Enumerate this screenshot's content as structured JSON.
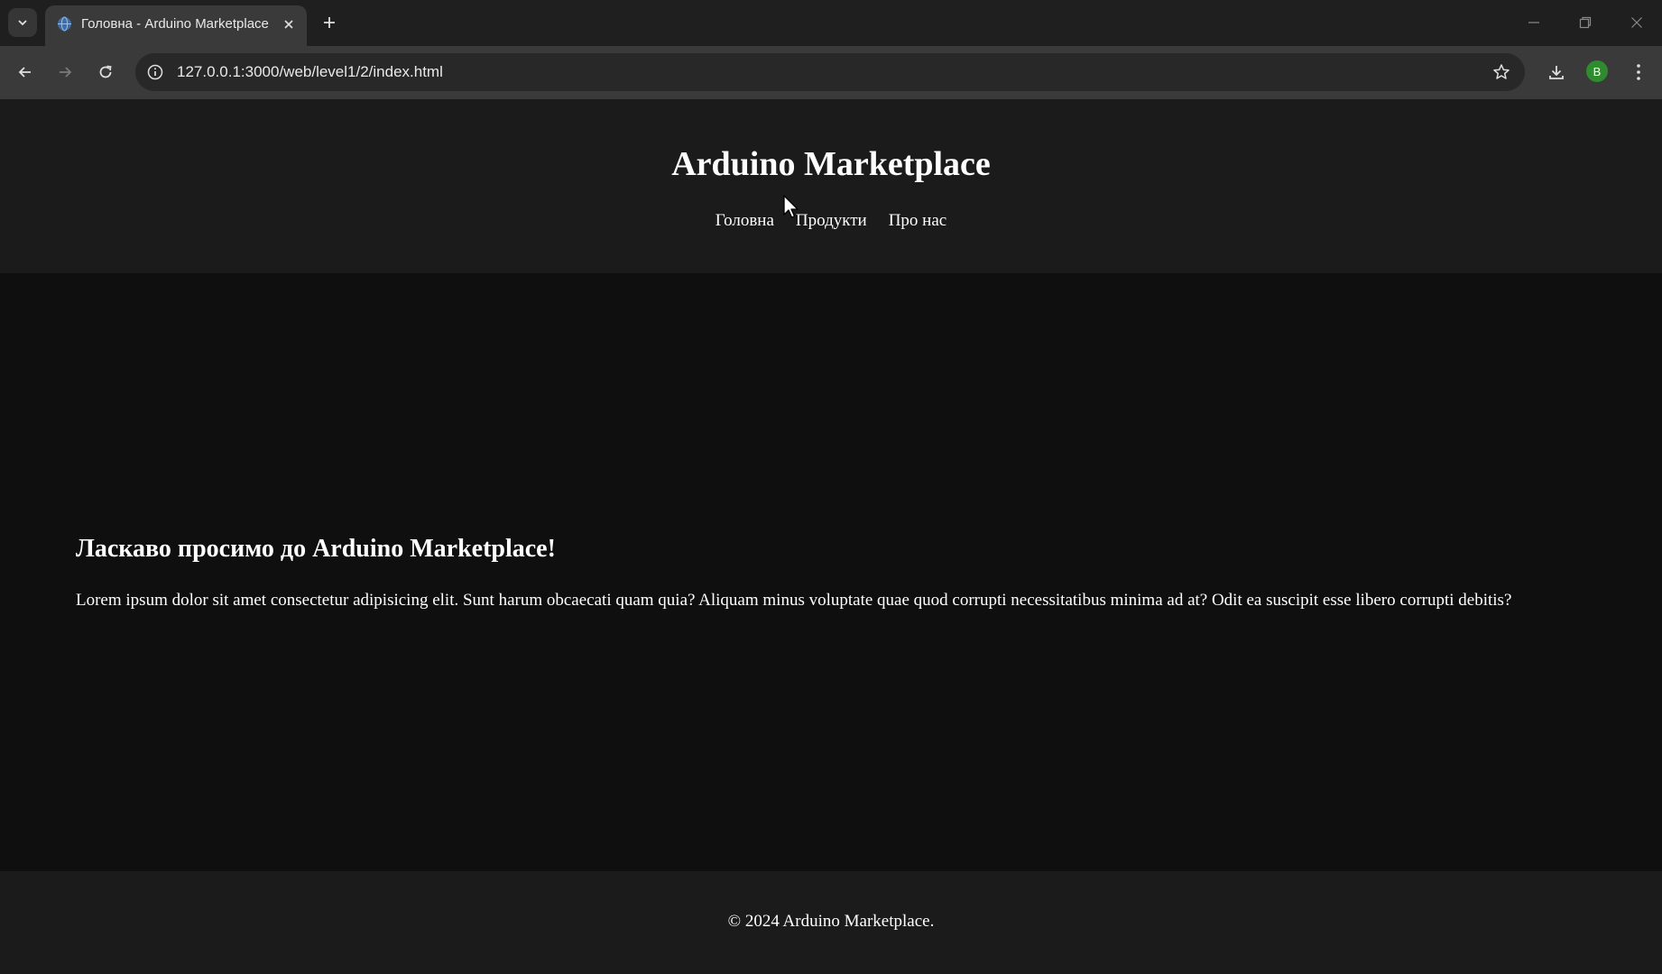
{
  "browser": {
    "tab_title": "Головна - Arduino Marketplace",
    "url": "127.0.0.1:3000/web/level1/2/index.html",
    "profile_initial": "B",
    "icons": {
      "tab_list": "chevron-down-icon",
      "favicon": "globe-icon",
      "tab_close": "close-icon",
      "new_tab": "plus-icon",
      "back": "arrow-left-icon",
      "forward": "arrow-right-icon",
      "reload": "reload-icon",
      "site_info": "info-icon",
      "bookmark": "star-icon",
      "downloads": "download-icon",
      "menu": "kebab-menu-icon",
      "minimize": "minimize-icon",
      "restore": "restore-icon",
      "close_window": "close-icon"
    },
    "colors": {
      "tabstrip": "#1f1f1f",
      "toolbar": "#3a3a3a",
      "omnibox": "#282828",
      "avatar": "#2e8b2e"
    }
  },
  "site": {
    "title": "Arduino Marketplace",
    "nav": {
      "home": "Головна",
      "products": "Продукти",
      "about": "Про нас"
    },
    "welcome_heading": "Ласкаво просимо до Arduino Marketplace!",
    "welcome_text": "Lorem ipsum dolor sit amet consectetur adipisicing elit. Sunt harum obcaecati quam quia? Aliquam minus voluptate quae quod corrupti necessitatibus minima ad at? Odit ea suscipit esse libero corrupti debitis?",
    "footer": "© 2024 Arduino Marketplace.",
    "colors": {
      "header_bg": "#1b1b1b",
      "main_bg": "#0f0f10",
      "text": "#ffffff"
    }
  }
}
